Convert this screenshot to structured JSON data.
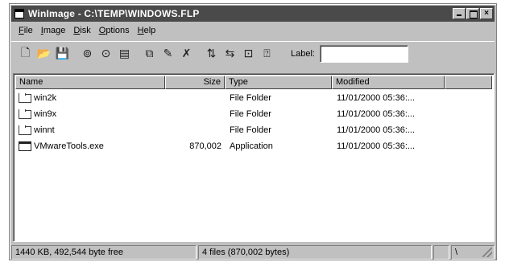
{
  "window": {
    "title": "WinImage - C:\\TEMP\\WINDOWS.FLP",
    "caption_buttons": {
      "minimize": "",
      "maximize": "",
      "close": "×"
    }
  },
  "menu": [
    {
      "first": "F",
      "rest": "ile"
    },
    {
      "first": "I",
      "rest": "mage"
    },
    {
      "first": "D",
      "rest": "isk"
    },
    {
      "first": "O",
      "rest": "ptions"
    },
    {
      "first": "H",
      "rest": "elp"
    }
  ],
  "toolbar": {
    "icons": [
      {
        "name": "new-icon",
        "glyph": "🗋"
      },
      {
        "name": "open-icon",
        "glyph": "📂"
      },
      {
        "name": "save-icon",
        "glyph": "💾"
      },
      {
        "name": "read-disk-icon",
        "glyph": "⊚"
      },
      {
        "name": "write-disk-icon",
        "glyph": "⊙"
      },
      {
        "name": "format-icon",
        "glyph": "▤"
      },
      {
        "name": "extract-icon",
        "glyph": "⧉"
      },
      {
        "name": "inject-icon",
        "glyph": "✎"
      },
      {
        "name": "delete-icon",
        "glyph": "✗"
      },
      {
        "name": "sort-name-icon",
        "glyph": "⇅"
      },
      {
        "name": "sort-ext-icon",
        "glyph": "⇆"
      },
      {
        "name": "info-icon",
        "glyph": "⊡"
      },
      {
        "name": "help-icon",
        "glyph": "⍰"
      }
    ],
    "label_text": "Label:",
    "label_value": ""
  },
  "columns": {
    "name": "Name",
    "size": "Size",
    "type": "Type",
    "modified": "Modified"
  },
  "files": [
    {
      "icon": "folder-icon",
      "name": "win2k",
      "size": "",
      "type": "File Folder",
      "modified": "11/01/2000  05:36:..."
    },
    {
      "icon": "folder-icon",
      "name": "win9x",
      "size": "",
      "type": "File Folder",
      "modified": "11/01/2000  05:36:..."
    },
    {
      "icon": "folder-icon",
      "name": "winnt",
      "size": "",
      "type": "File Folder",
      "modified": "11/01/2000  05:36:..."
    },
    {
      "icon": "application-icon",
      "name": "VMwareTools.exe",
      "size": "870,002",
      "type": "Application",
      "modified": "11/01/2000  05:36:..."
    }
  ],
  "status": {
    "disk_info": "1440 KB, 492,544 byte free",
    "files_info": "4 files (870,002 bytes)",
    "extra": "\\"
  },
  "colors": {
    "titlebar": "#4a4a4a",
    "face": "#c0c0c0",
    "list_bg": "#ffffff"
  }
}
